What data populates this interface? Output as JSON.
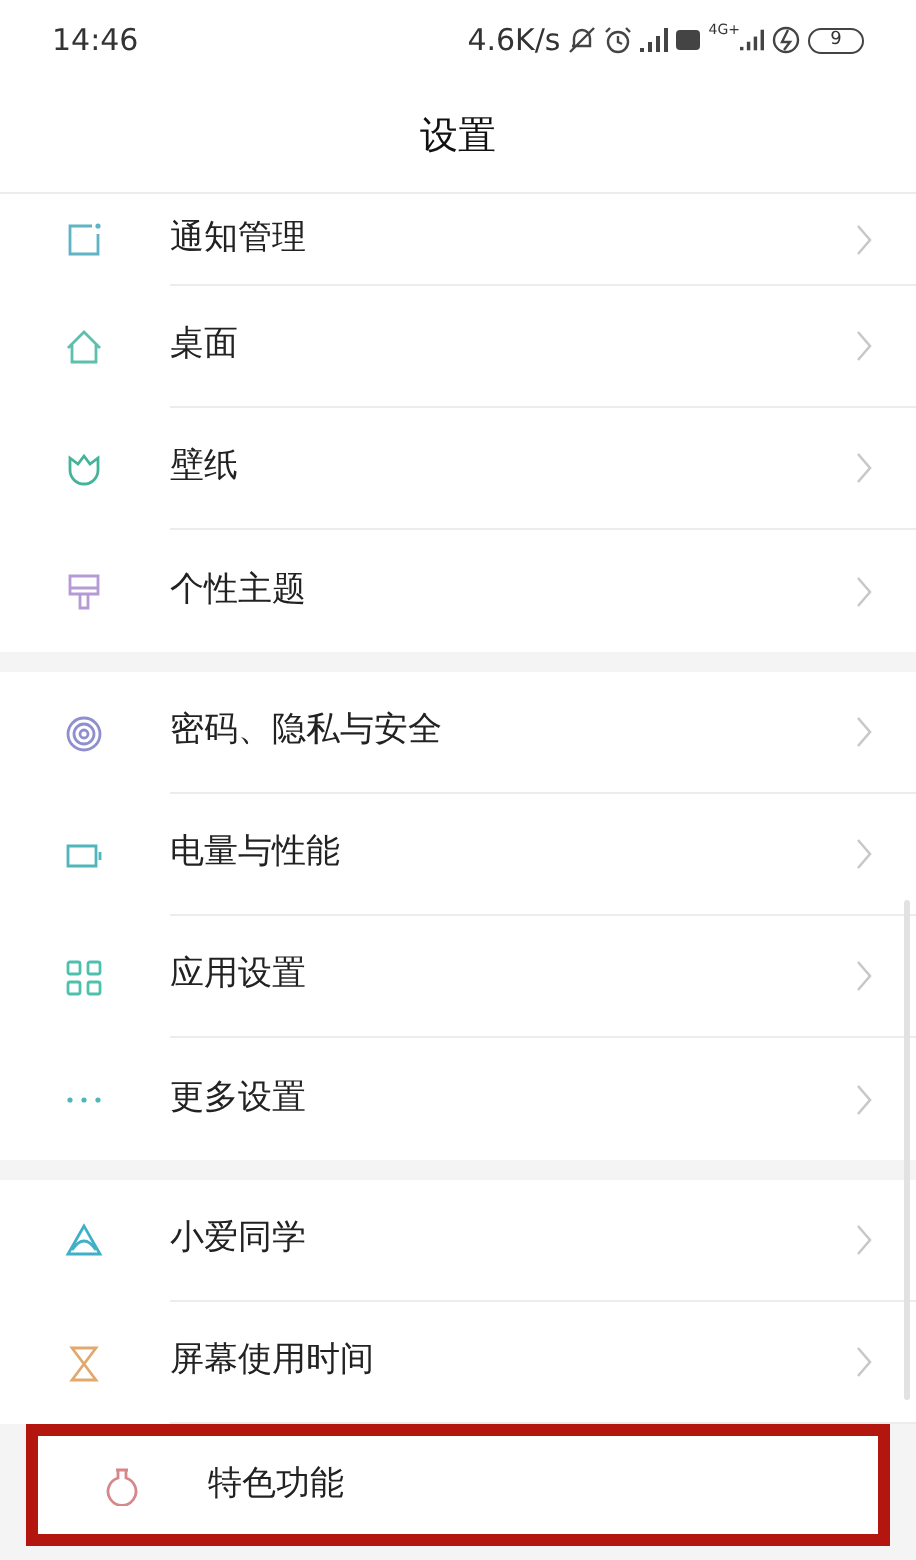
{
  "status_bar": {
    "time": "14:46",
    "speed": "4.6K/s",
    "network": "4G+",
    "battery": "9"
  },
  "header": {
    "title": "设置"
  },
  "groups": [
    {
      "items": [
        {
          "label": "通知管理",
          "highlighted": false
        },
        {
          "label": "桌面",
          "highlighted": false
        },
        {
          "label": "壁纸",
          "highlighted": false
        },
        {
          "label": "个性主题",
          "highlighted": false
        }
      ]
    },
    {
      "items": [
        {
          "label": "密码、隐私与安全",
          "highlighted": false
        },
        {
          "label": "电量与性能",
          "highlighted": false
        },
        {
          "label": "应用设置",
          "highlighted": false
        },
        {
          "label": "更多设置",
          "highlighted": false
        }
      ]
    },
    {
      "items": [
        {
          "label": "小爱同学",
          "highlighted": false
        },
        {
          "label": "屏幕使用时间",
          "highlighted": false
        },
        {
          "label": "特色功能",
          "highlighted": true
        }
      ]
    }
  ]
}
